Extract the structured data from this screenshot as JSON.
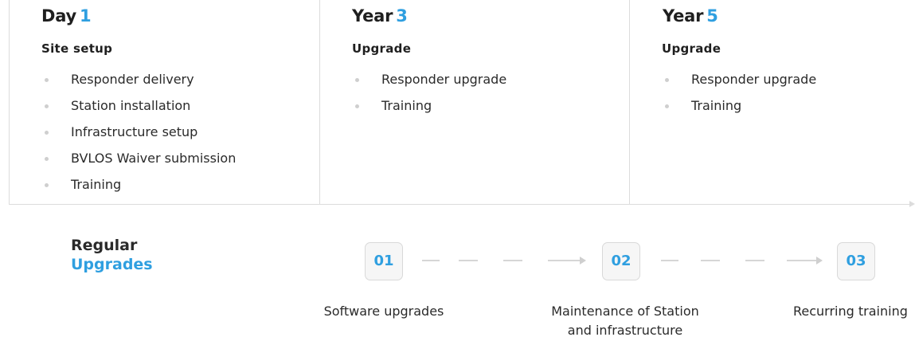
{
  "phases": [
    {
      "prefix": "Day",
      "number": "1",
      "subtitle": "Site setup",
      "items": [
        "Responder delivery",
        "Station installation",
        "Infrastructure setup",
        "BVLOS Waiver submission",
        "Training"
      ]
    },
    {
      "prefix": "Year",
      "number": "3",
      "subtitle": "Upgrade",
      "items": [
        "Responder upgrade",
        "Training"
      ]
    },
    {
      "prefix": "Year",
      "number": "5",
      "subtitle": "Upgrade",
      "items": [
        "Responder upgrade",
        "Training"
      ]
    }
  ],
  "regular": {
    "line1": "Regular",
    "line2": "Upgrades"
  },
  "steps": [
    {
      "number": "01",
      "label": "Software upgrades"
    },
    {
      "number": "02",
      "label_line1": "Maintenance of Station",
      "label_line2": "and infrastructure"
    },
    {
      "number": "03",
      "label": "Recurring training"
    }
  ],
  "colors": {
    "accent": "#2f9fe0",
    "text": "#1f1f1f",
    "divider": "#dcdcdc"
  }
}
